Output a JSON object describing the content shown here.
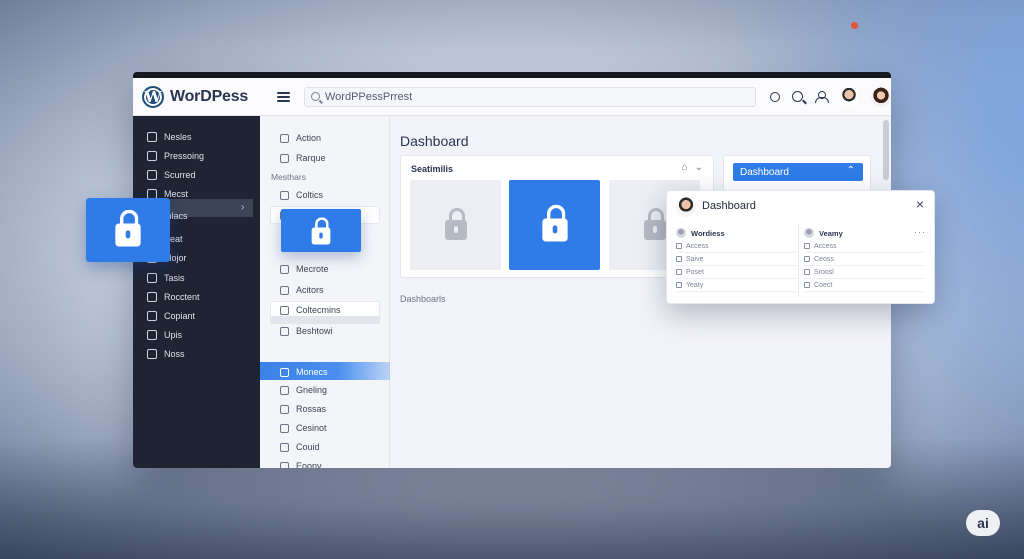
{
  "brand": {
    "name": "WorDPess",
    "logo_letter": "W"
  },
  "search": {
    "value": "WordPPessPrrest"
  },
  "sidebar": {
    "items": [
      "Nesles",
      "Pressoing",
      "Scurred",
      "Mecst",
      "Inlacs",
      "Peat",
      "Mojor",
      "Tasis",
      "Rocctent",
      "Copiant",
      "Upis",
      "Noss"
    ],
    "chevron": "›"
  },
  "subnav": {
    "items_top": [
      "Action",
      "Rarque"
    ],
    "section_label": "Mesthars",
    "items_mid": [
      "Coltics",
      "Naste",
      "Mecrote",
      "Acitors",
      "Coltecmins",
      "Beshtowi"
    ],
    "items_bottom": [
      "Monecs",
      "Gneling",
      "Rossas",
      "Cesinot",
      "Couid",
      "Eoony"
    ]
  },
  "main": {
    "title": "Dashboard",
    "card_title": "Seatimilis",
    "card_icons": [
      "⌂",
      "⌄"
    ],
    "dashboards_label": "Dashboarls",
    "dropdown_label": "Dashboard",
    "dropdown_chevron": "⌃"
  },
  "popover": {
    "title": "Dashboard",
    "close": "×",
    "more": "···",
    "left": {
      "head": "Wordiess",
      "rows": [
        "Access",
        "Saive",
        "Poset",
        "Yeaty"
      ]
    },
    "right": {
      "head": "Veamy",
      "rows": [
        "Access",
        "Ceoss",
        "Sroosl",
        "Coect"
      ]
    }
  },
  "badge": "ai",
  "colors": {
    "accent": "#2f7ce8",
    "sidebar": "#1e2432",
    "brand": "#1f4e79"
  }
}
